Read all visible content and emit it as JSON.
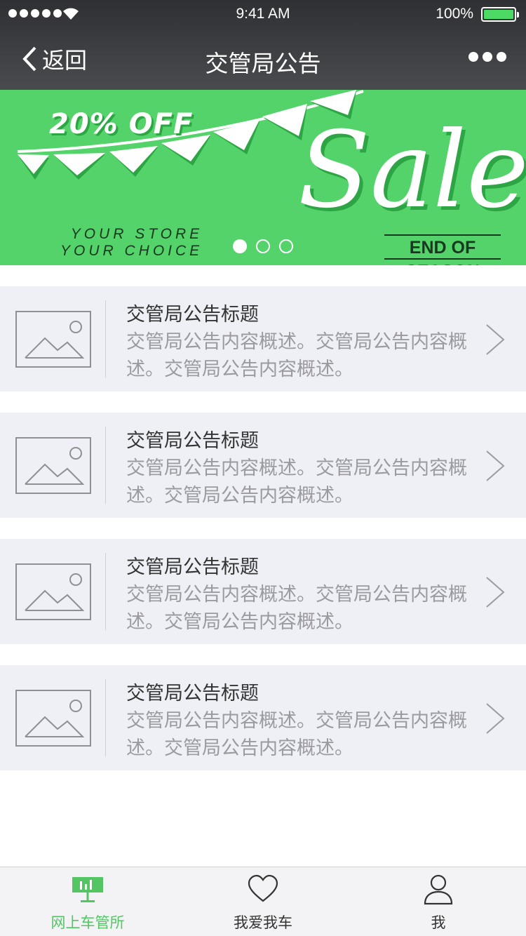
{
  "status_bar": {
    "time": "9:41 AM",
    "battery": "100%"
  },
  "nav": {
    "back_label": "返回",
    "title": "交管局公告"
  },
  "banner": {
    "discount": "20% OFF",
    "store_line1": "YOUR STORE",
    "store_line2": "YOUR CHOICE",
    "sale": "Sale",
    "season": "END OF SEASON",
    "page_count": 3,
    "active_page": 1,
    "color": "#53d36a"
  },
  "notices": [
    {
      "title": "交管局公告标题",
      "desc": "交管局公告内容概述。交管局公告内容概述。交管局公告内容概述。"
    },
    {
      "title": "交管局公告标题",
      "desc": "交管局公告内容概述。交管局公告内容概述。交管局公告内容概述。"
    },
    {
      "title": "交管局公告标题",
      "desc": "交管局公告内容概述。交管局公告内容概述。交管局公告内容概述。"
    },
    {
      "title": "交管局公告标题",
      "desc": "交管局公告内容概述。交管局公告内容概述。交管局公告内容概述。"
    }
  ],
  "tabbar": [
    {
      "label": "网上车管所",
      "icon": "dashboard-icon",
      "active": true
    },
    {
      "label": "我爱我车",
      "icon": "heart-icon",
      "active": false
    },
    {
      "label": "我",
      "icon": "user-icon",
      "active": false
    }
  ],
  "colors": {
    "accent": "#53c563",
    "nav_bg": "#3a3b3e",
    "list_bg": "#eef0f5"
  }
}
